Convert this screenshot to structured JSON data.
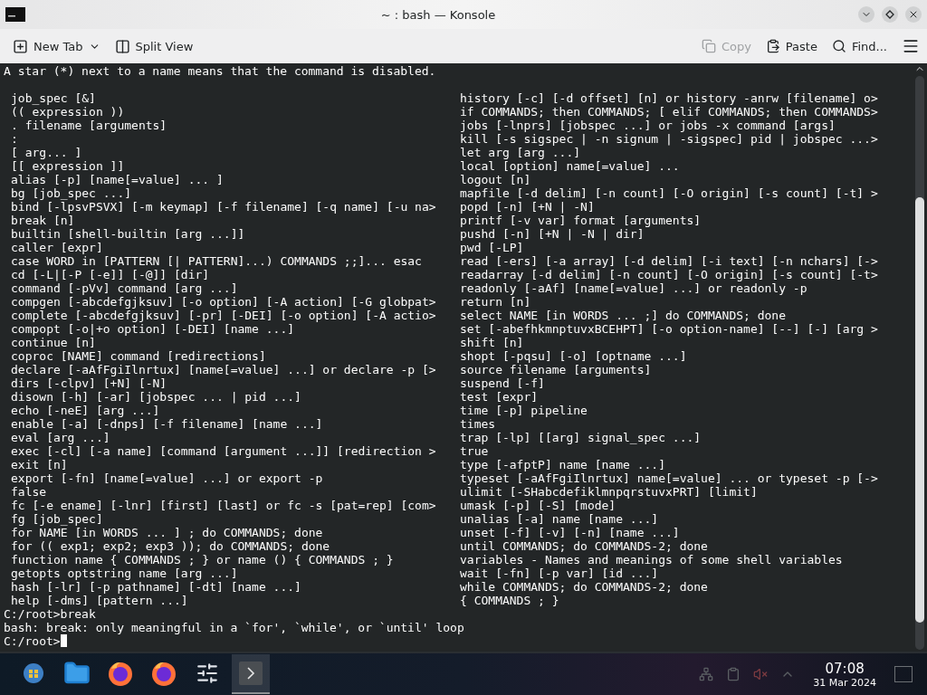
{
  "window": {
    "title": "~ : bash — Konsole"
  },
  "toolbar": [
    {
      "label": "New Tab",
      "kind": "new-tab",
      "disabled": false,
      "menu": true
    },
    {
      "label": "Split View",
      "kind": "split",
      "disabled": false,
      "menu": false
    },
    {
      "label": "Copy",
      "kind": "copy",
      "disabled": true,
      "menu": false
    },
    {
      "label": "Paste",
      "kind": "paste",
      "disabled": false,
      "menu": false
    },
    {
      "label": "Find...",
      "kind": "find",
      "disabled": false,
      "menu": false
    }
  ],
  "terminal": {
    "header": "A star (*) next to a name means that the command is disabled.",
    "column_1": [
      "job_spec [&]",
      "(( expression ))",
      ". filename [arguments]",
      ":",
      "[ arg... ]",
      "[[ expression ]]",
      "alias [-p] [name[=value] ... ]",
      "bg [job_spec ...]",
      "bind [-lpsvPSVX] [-m keymap] [-f filename] [-q name] [-u na>",
      "break [n]",
      "builtin [shell-builtin [arg ...]]",
      "caller [expr]",
      "case WORD in [PATTERN [| PATTERN]...) COMMANDS ;;]... esac",
      "cd [-L|[-P [-e]] [-@]] [dir]",
      "command [-pVv] command [arg ...]",
      "compgen [-abcdefgjksuv] [-o option] [-A action] [-G globpat>",
      "complete [-abcdefgjksuv] [-pr] [-DEI] [-o option] [-A actio>",
      "compopt [-o|+o option] [-DEI] [name ...]",
      "continue [n]",
      "coproc [NAME] command [redirections]",
      "declare [-aAfFgiIlnrtux] [name[=value] ...] or declare -p [>",
      "dirs [-clpv] [+N] [-N]",
      "disown [-h] [-ar] [jobspec ... | pid ...]",
      "echo [-neE] [arg ...]",
      "enable [-a] [-dnps] [-f filename] [name ...]",
      "eval [arg ...]",
      "exec [-cl] [-a name] [command [argument ...]] [redirection >",
      "exit [n]",
      "export [-fn] [name[=value] ...] or export -p",
      "false",
      "fc [-e ename] [-lnr] [first] [last] or fc -s [pat=rep] [com>",
      "fg [job_spec]",
      "for NAME [in WORDS ... ] ; do COMMANDS; done",
      "for (( exp1; exp2; exp3 )); do COMMANDS; done",
      "function name { COMMANDS ; } or name () { COMMANDS ; }",
      "getopts optstring name [arg ...]",
      "hash [-lr] [-p pathname] [-dt] [name ...]",
      "help [-dms] [pattern ...]"
    ],
    "column_2": [
      "history [-c] [-d offset] [n] or history -anrw [filename] o>",
      "if COMMANDS; then COMMANDS; [ elif COMMANDS; then COMMANDS>",
      "jobs [-lnprs] [jobspec ...] or jobs -x command [args]",
      "kill [-s sigspec | -n signum | -sigspec] pid | jobspec ...>",
      "let arg [arg ...]",
      "local [option] name[=value] ...",
      "logout [n]",
      "mapfile [-d delim] [-n count] [-O origin] [-s count] [-t] >",
      "popd [-n] [+N | -N]",
      "printf [-v var] format [arguments]",
      "pushd [-n] [+N | -N | dir]",
      "pwd [-LP]",
      "read [-ers] [-a array] [-d delim] [-i text] [-n nchars] [->",
      "readarray [-d delim] [-n count] [-O origin] [-s count] [-t>",
      "readonly [-aAf] [name[=value] ...] or readonly -p",
      "return [n]",
      "select NAME [in WORDS ... ;] do COMMANDS; done",
      "set [-abefhkmnptuvxBCEHPT] [-o option-name] [--] [-] [arg >",
      "shift [n]",
      "shopt [-pqsu] [-o] [optname ...]",
      "source filename [arguments]",
      "suspend [-f]",
      "test [expr]",
      "time [-p] pipeline",
      "times",
      "trap [-lp] [[arg] signal_spec ...]",
      "true",
      "type [-afptP] name [name ...]",
      "typeset [-aAfFgiIlnrtux] name[=value] ... or typeset -p [->",
      "ulimit [-SHabcdefiklmnpqrstuvxPRT] [limit]",
      "umask [-p] [-S] [mode]",
      "unalias [-a] name [name ...]",
      "unset [-f] [-v] [-n] [name ...]",
      "until COMMANDS; do COMMANDS-2; done",
      "variables - Names and meanings of some shell variables",
      "wait [-fn] [-p var] [id ...]",
      "while COMMANDS; do COMMANDS-2; done",
      "{ COMMANDS ; }"
    ],
    "output": [
      "C:/root>break",
      "bash: break: only meaningful in a `for', `while', or `until' loop"
    ],
    "prompt": "C:/root>"
  },
  "taskbar": {
    "apps": [
      {
        "kind": "start",
        "selected": false
      },
      {
        "kind": "files",
        "selected": false
      },
      {
        "kind": "firefox",
        "selected": false
      },
      {
        "kind": "firefox",
        "selected": false
      },
      {
        "kind": "settings",
        "selected": false
      },
      {
        "kind": "terminal",
        "selected": true
      }
    ],
    "time": "07:08",
    "date": "31 Mar 2024"
  }
}
